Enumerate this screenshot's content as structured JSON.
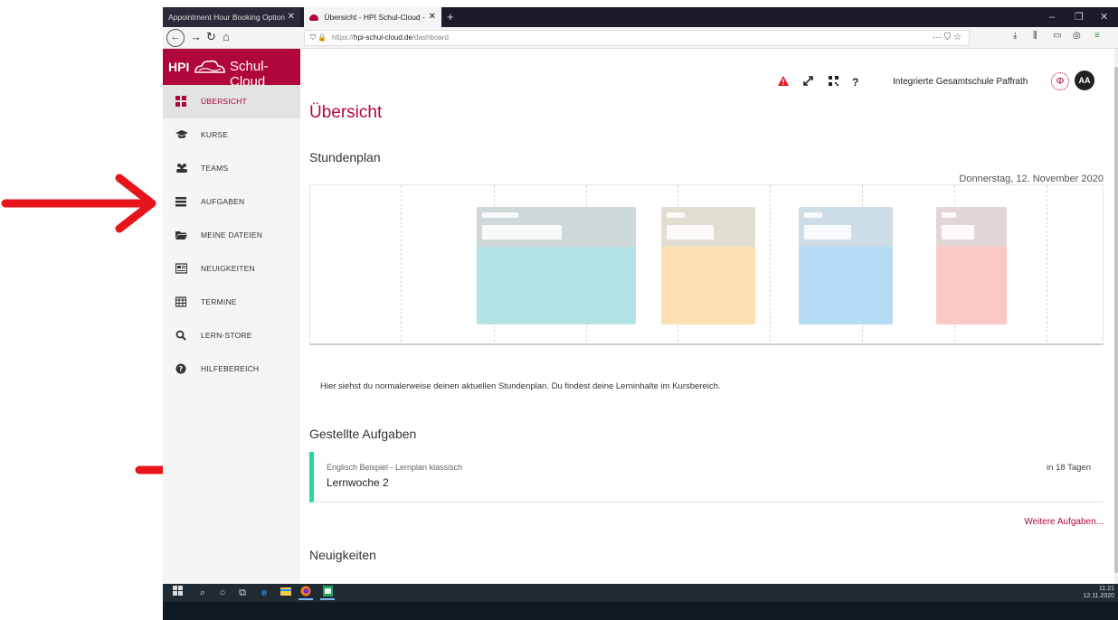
{
  "browser": {
    "tabs": [
      {
        "title": "Appointment Hour Booking Option"
      },
      {
        "title": "Übersicht - HPI Schul-Cloud - "
      }
    ],
    "url": {
      "prefix": "https://",
      "host": "hpi-schul-cloud.de",
      "path": "/dashboard"
    },
    "new_tab": "+",
    "close": "✕"
  },
  "sidebar": {
    "brand_hpi": "HPI",
    "brand_name": "Schul-Cloud",
    "items": [
      {
        "label": "ÜBERSICHT",
        "icon": "dashboard-icon",
        "active": true
      },
      {
        "label": "KURSE",
        "icon": "graduation-cap-icon"
      },
      {
        "label": "TEAMS",
        "icon": "users-icon"
      },
      {
        "label": "AUFGABEN",
        "icon": "tasks-icon"
      },
      {
        "label": "MEINE DATEIEN",
        "icon": "folder-icon"
      },
      {
        "label": "NEUIGKEITEN",
        "icon": "newspaper-icon"
      },
      {
        "label": "TERMINE",
        "icon": "calendar-icon"
      },
      {
        "label": "LERN-STORE",
        "icon": "search-icon"
      },
      {
        "label": "HILFEBEREICH",
        "icon": "help-icon"
      }
    ]
  },
  "topbar": {
    "help": "?",
    "school": "Integrierte Gesamtschule Paffrath",
    "avatar": "AA"
  },
  "main": {
    "title": "Übersicht",
    "schedule_heading": "Stundenplan",
    "schedule_date": "Donnerstag, 12. November 2020",
    "schedule_note": "Hier siehst du normalerweise deinen aktuellen Stundenplan. Du findest deine Lerninhalte im Kursbereich.",
    "tasks_heading": "Gestellte Aufgaben",
    "task": {
      "course": "Englisch Beispiel - Lernplan klassisch",
      "title": "Lernwoche 2",
      "due": "in 18 Tagen"
    },
    "more_tasks": "Weitere Aufgaben...",
    "news_heading": "Neuigkeiten"
  },
  "taskbar": {
    "time": "11:21",
    "date": "12.11.2020"
  },
  "colors": {
    "brand": "#b1063a",
    "task_accent": "#26d6a3",
    "arrow": "#e8141b"
  }
}
